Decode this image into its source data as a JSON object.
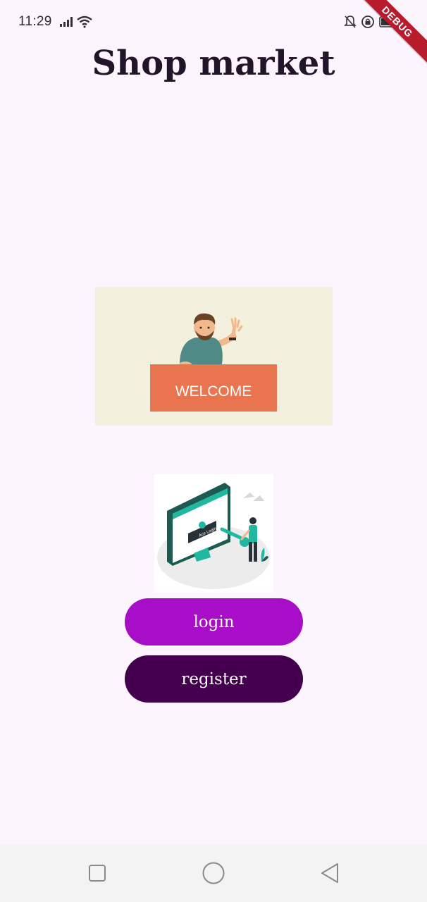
{
  "status_bar": {
    "time": "11:29",
    "icons": [
      "signal-icon",
      "wifi-icon",
      "mute-icon",
      "vpn-icon",
      "battery-icon"
    ]
  },
  "debug_banner": {
    "label": "DEBUG"
  },
  "app": {
    "title": "Shop market"
  },
  "welcome_image": {
    "sign_text": "WELCOME"
  },
  "login_illustration": {
    "screen_text": "Ace Login"
  },
  "buttons": {
    "login_label": "login",
    "register_label": "register"
  },
  "nav_bar": {
    "icons": [
      "recents-icon",
      "home-icon",
      "back-icon"
    ]
  },
  "colors": {
    "background": "#fcf5fd",
    "login_button": "#a80ec8",
    "register_button": "#44004f",
    "welcome_sign": "#e8754f",
    "illustration_accent": "#21b8a2"
  }
}
